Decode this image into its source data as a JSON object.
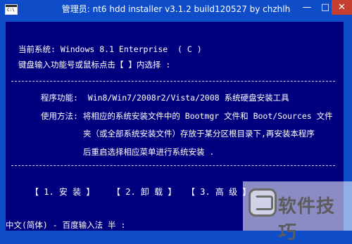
{
  "window": {
    "title": "管理员:  nt6 hdd installer v3.1.2 build120527 by chzhlh",
    "minimize": "—",
    "maximize": "□",
    "close": "✕"
  },
  "app_icon": {
    "name": "console-icon",
    "prompt": "C:\\"
  },
  "console": {
    "current_system": "当前系统: Windows 8.1 Enterprise  ( C )",
    "prompt": "键盘输入功能号或鼠标点击【 】内选择 :",
    "feature": "程序功能:  Win8/Win7/2008r2/Vista/2008 系统硬盘安装工具",
    "usage_1": "使用方法: 将相应的系统安装文件中的 Bootmgr 文件和 Boot/Sources 文件",
    "usage_2": "夹（或全部系统安装文件）存放于某分区根目录下,再安装本程序",
    "usage_3": "后重启选择相应菜单进行系统安装 .",
    "menu": [
      {
        "label": "【 1. 安 装 】"
      },
      {
        "label": "【 2. 卸 载 】"
      },
      {
        "label": "【 3. 高 级 】"
      }
    ],
    "ime_status": "中文(简体) - 百度输入法 半 :"
  },
  "watermark": {
    "text": "软件技巧"
  }
}
